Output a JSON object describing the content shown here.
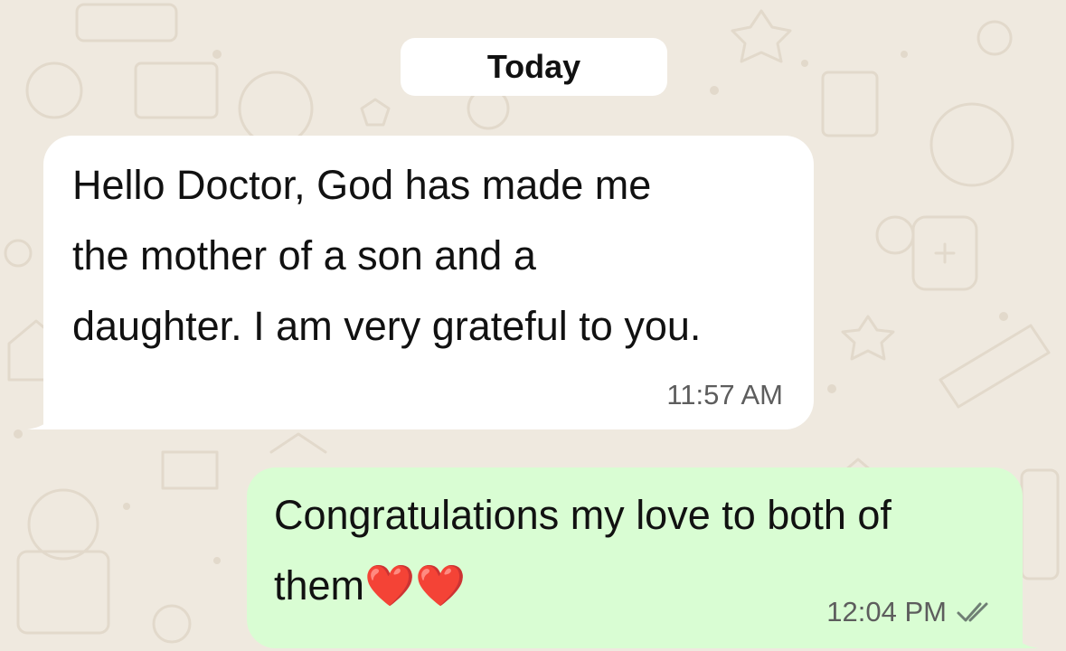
{
  "chat": {
    "date_label": "Today",
    "messages": [
      {
        "direction": "incoming",
        "text": "Hello Doctor, God has made me\nthe mother of a son and a\ndaughter. I am very grateful to you.",
        "time": "11:57 AM"
      },
      {
        "direction": "outgoing",
        "text": "Congratulations my love to both of\nthem❤️❤️",
        "time": "12:04 PM",
        "status_icon": "double-check-icon"
      }
    ]
  },
  "colors": {
    "wallpaper": "#efe9df",
    "incoming_bubble": "#ffffff",
    "outgoing_bubble": "#d9fdd3",
    "timestamp": "#5d5d5d"
  }
}
